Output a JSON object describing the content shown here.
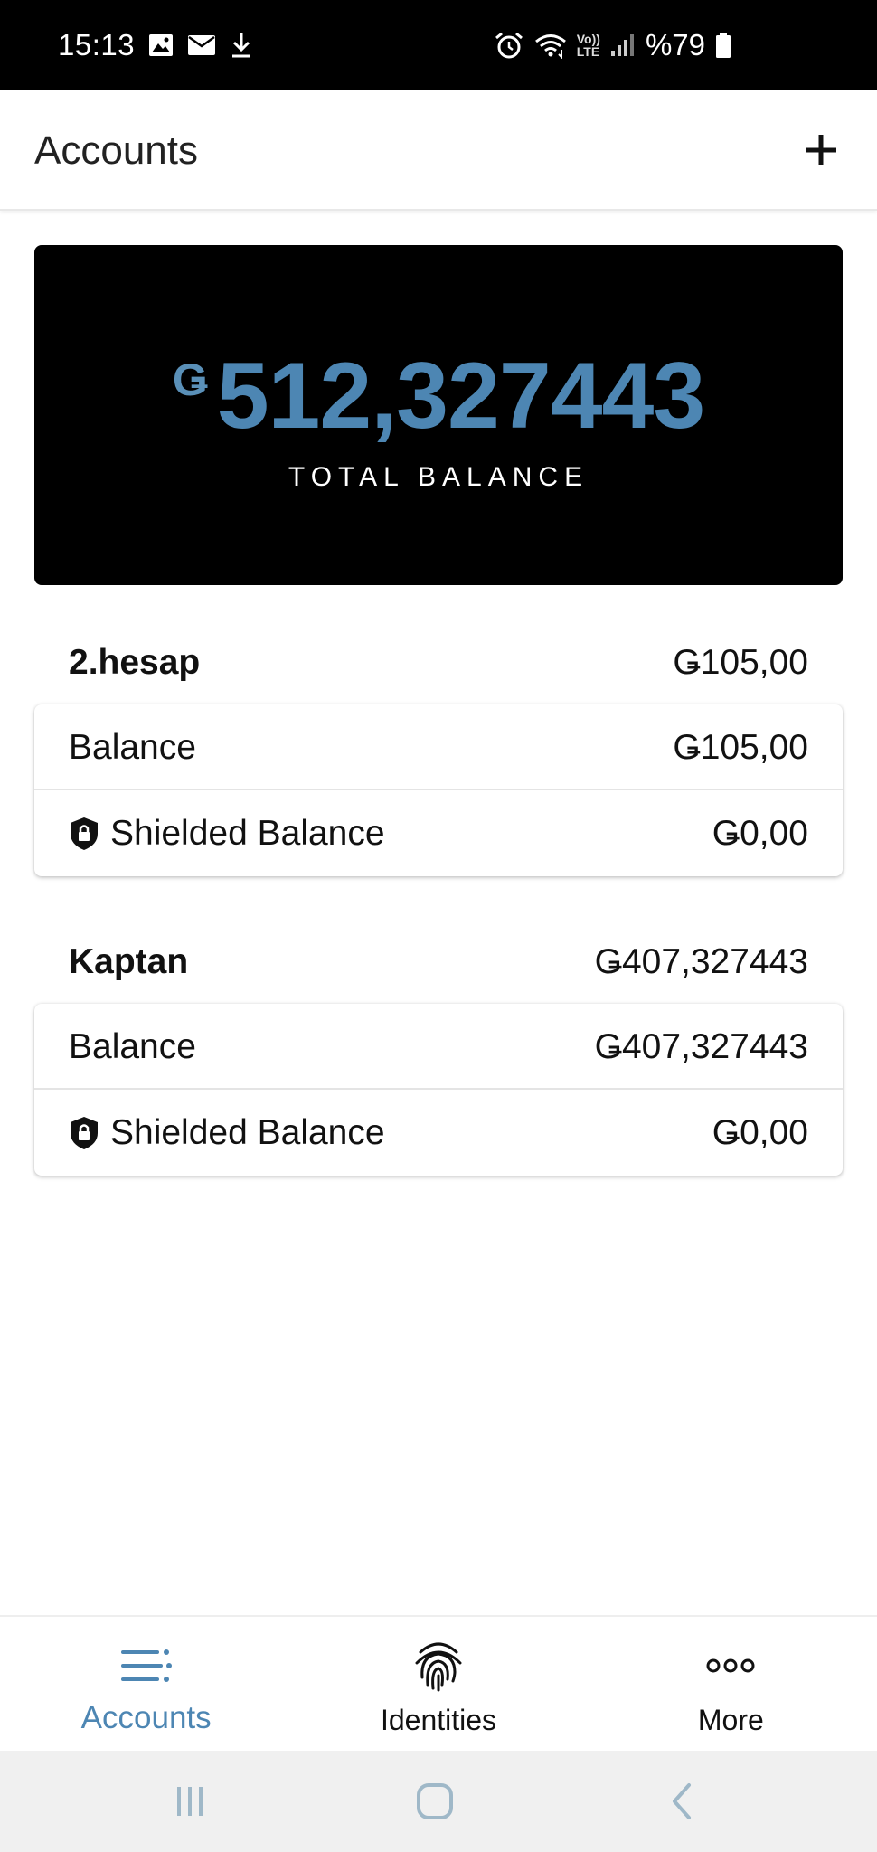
{
  "status_bar": {
    "time": "15:13",
    "battery": "%79",
    "left_icons": [
      "image-icon",
      "mail-icon",
      "download-icon"
    ],
    "right_icons": [
      "alarm-icon",
      "wifi-icon",
      "volte-icon",
      "signal-icon",
      "battery-icon"
    ],
    "volte_top": "Vo))",
    "volte_bottom": "LTE"
  },
  "app_bar": {
    "title": "Accounts",
    "add_icon": "plus-icon"
  },
  "total": {
    "symbol": "Ǥ",
    "value": "512,327443",
    "label": "TOTAL BALANCE"
  },
  "accounts": [
    {
      "name": "2.hesap",
      "total": "Ǥ105,00",
      "balance_label": "Balance",
      "balance_value": "Ǥ105,00",
      "shielded_label": "Shielded Balance",
      "shielded_value": "Ǥ0,00"
    },
    {
      "name": "Kaptan",
      "total": "Ǥ407,327443",
      "balance_label": "Balance",
      "balance_value": "Ǥ407,327443",
      "shielded_label": "Shielded Balance",
      "shielded_value": "Ǥ0,00"
    }
  ],
  "bottom_nav": {
    "items": [
      {
        "label": "Accounts",
        "icon": "list-icon",
        "active": true
      },
      {
        "label": "Identities",
        "icon": "fingerprint-icon",
        "active": false
      },
      {
        "label": "More",
        "icon": "more-icon",
        "active": false
      }
    ]
  },
  "colors": {
    "accent": "#4d86b3",
    "card_bg": "#000000",
    "system_nav_bg": "#f0f0f0",
    "system_nav_icon": "#9fb8c8"
  }
}
